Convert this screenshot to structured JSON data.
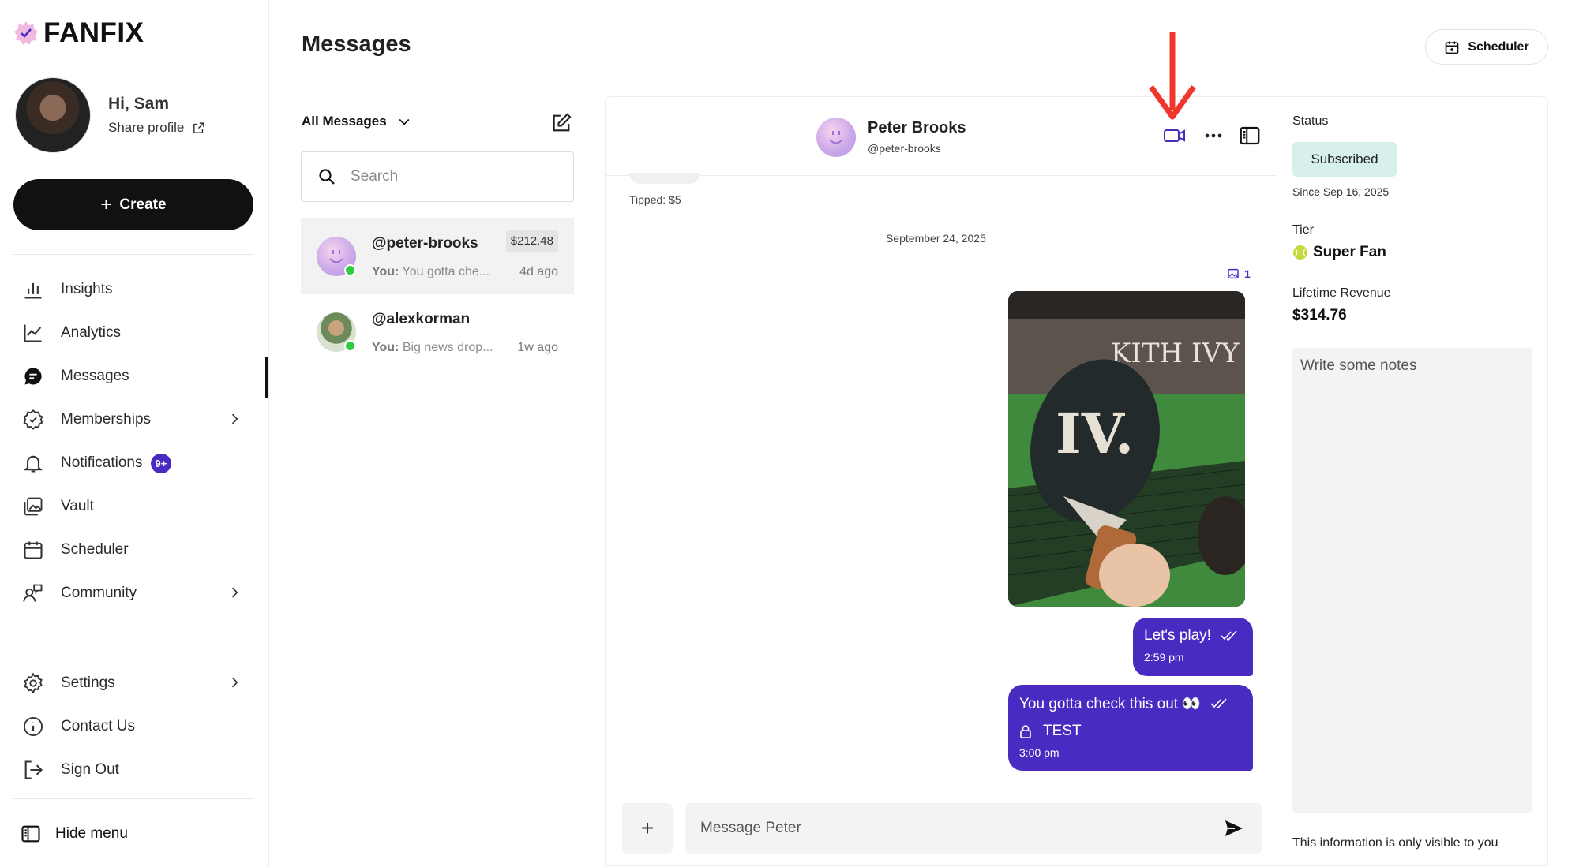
{
  "brand": {
    "name": "FANFIX",
    "accent": "#4a2bc2"
  },
  "profile": {
    "greeting": "Hi, Sam",
    "share_label": "Share profile"
  },
  "create_label": "Create",
  "nav": {
    "insights": "Insights",
    "analytics": "Analytics",
    "messages": "Messages",
    "memberships": "Memberships",
    "notifications": "Notifications",
    "notifications_badge": "9+",
    "vault": "Vault",
    "scheduler": "Scheduler",
    "community": "Community",
    "settings": "Settings",
    "contact": "Contact Us",
    "signout": "Sign Out",
    "hide_menu": "Hide menu"
  },
  "page": {
    "title": "Messages",
    "scheduler_button": "Scheduler"
  },
  "inbox": {
    "filter_label": "All Messages",
    "search_placeholder": "Search",
    "conversations": [
      {
        "handle": "@peter-brooks",
        "amount": "$212.48",
        "preview_prefix": "You:",
        "preview": "You gotta che...",
        "time": "4d ago"
      },
      {
        "handle": "@alexkorman",
        "preview_prefix": "You:",
        "preview": "Big news drop...",
        "time": "1w ago"
      }
    ]
  },
  "chat": {
    "name": "Peter Brooks",
    "handle": "@peter-brooks",
    "tipped": "Tipped: $5",
    "date_separator": "September 24, 2025",
    "image_count": "1",
    "messages": [
      {
        "text": "Let's play!",
        "time": "2:59 pm"
      },
      {
        "text": "You gotta check this out 👀",
        "locked_label": "TEST",
        "time": "3:00 pm"
      }
    ],
    "composer_placeholder": "Message Peter"
  },
  "details": {
    "status_label": "Status",
    "status": "Subscribed",
    "since": "Since Sep 16, 2025",
    "tier_label": "Tier",
    "tier": "Super Fan",
    "revenue_label": "Lifetime Revenue",
    "revenue": "$314.76",
    "notes_placeholder": "Write some notes",
    "visibility_note": "This information is only visible to you"
  }
}
